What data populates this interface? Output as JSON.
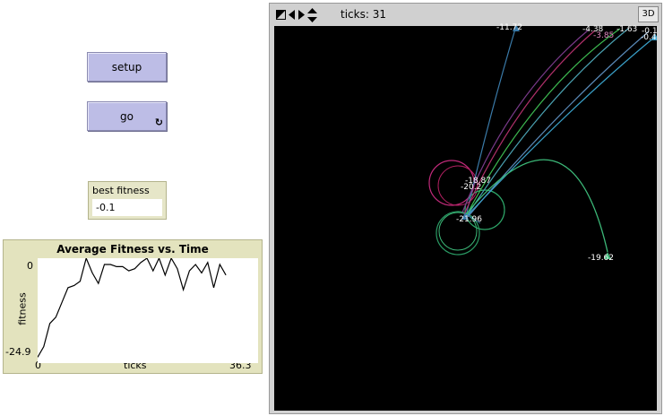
{
  "buttons": {
    "setup_label": "setup",
    "go_label": "go",
    "forever_glyph": "↻"
  },
  "monitor": {
    "label": "best fitness",
    "value": "-0.1"
  },
  "plot": {
    "title": "Average Fitness vs. Time",
    "y_label": "fitness",
    "x_label": "ticks",
    "y_max_label": "0",
    "y_min_label": "-24.9",
    "x_min_label": "0",
    "x_max_label": "36.3"
  },
  "view": {
    "ticks_label": "ticks: 31",
    "btn_3d": "3D",
    "icons": [
      "size-toggle-icon",
      "arrows-horizontal-icon",
      "arrows-vertical-icon"
    ],
    "turtle_labels": [
      "-11.72",
      "-4.38",
      "-3.85",
      "-1.63",
      "-0.1",
      "-0.4",
      "-18.87",
      "-20.2",
      "-21.96",
      "-19.62"
    ]
  },
  "chart_data": {
    "type": "line",
    "title": "Average Fitness vs. Time",
    "xlabel": "ticks",
    "ylabel": "fitness",
    "xlim": [
      0,
      36.3
    ],
    "ylim": [
      -24.9,
      0
    ],
    "series": [
      {
        "x": [
          0,
          1,
          2,
          3,
          4,
          5,
          6,
          7,
          8,
          9,
          10,
          11,
          12,
          13,
          14,
          15,
          16,
          17,
          18,
          19,
          20,
          21,
          22,
          23,
          24,
          25,
          26,
          27,
          28,
          29,
          30,
          31
        ],
        "values": [
          -23.5,
          -21,
          -15.5,
          -14,
          -10.5,
          -7,
          -6.5,
          -5.5,
          0,
          -3.5,
          -6,
          -1.5,
          -1.5,
          -2,
          -2,
          -3,
          -2.5,
          -1,
          0,
          -3,
          0,
          -4,
          0,
          -2.5,
          -7.5,
          -3,
          -1.5,
          -3.5,
          -1,
          -7,
          -1.5,
          -4
        ]
      }
    ],
    "colors": {
      "line": "#000000"
    }
  }
}
